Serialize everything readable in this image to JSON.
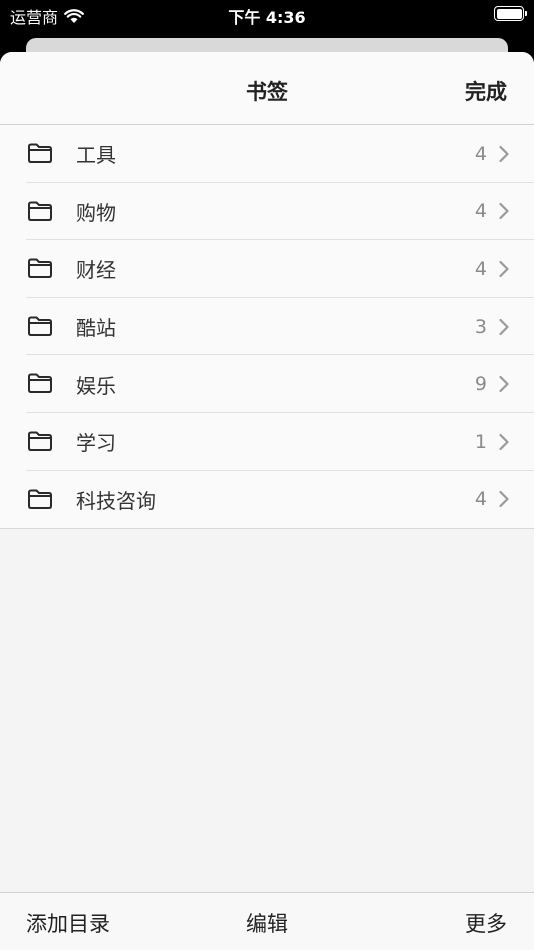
{
  "status_bar": {
    "carrier": "运营商",
    "time": "下午 4:36"
  },
  "nav": {
    "title": "书签",
    "done_label": "完成"
  },
  "folders": [
    {
      "label": "工具",
      "count": "4"
    },
    {
      "label": "购物",
      "count": "4"
    },
    {
      "label": "财经",
      "count": "4"
    },
    {
      "label": "酷站",
      "count": "3"
    },
    {
      "label": "娱乐",
      "count": "9"
    },
    {
      "label": "学习",
      "count": "1"
    },
    {
      "label": "科技咨询",
      "count": "4"
    }
  ],
  "toolbar": {
    "add_folder_label": "添加目录",
    "edit_label": "编辑",
    "more_label": "更多"
  },
  "icons": {
    "folder": "folder-icon",
    "chevron": "chevron-right-icon",
    "wifi": "wifi-icon",
    "battery": "battery-icon"
  }
}
